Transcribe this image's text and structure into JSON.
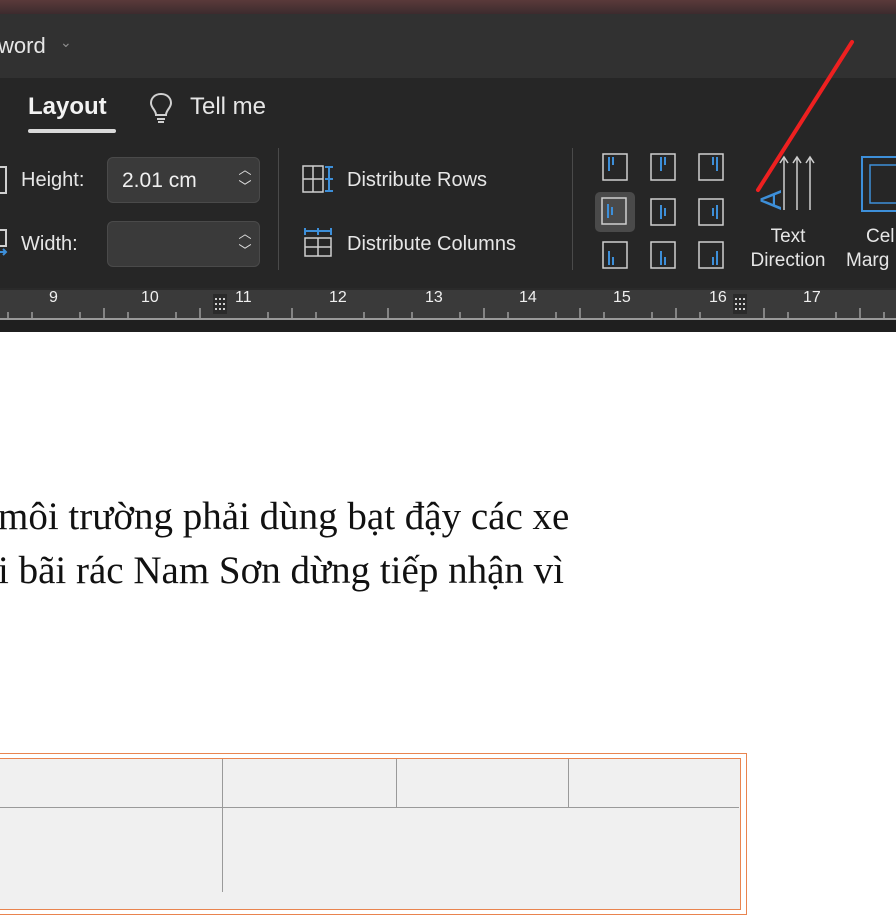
{
  "window": {
    "title": "word"
  },
  "tabs": [
    {
      "label": "Layout",
      "active": true
    },
    {
      "label": "Tell me",
      "icon": "lightbulb-icon"
    }
  ],
  "cell_size": {
    "height_label": "Height:",
    "height_value": "2.01 cm",
    "width_label": "Width:",
    "width_value": ""
  },
  "distribute": {
    "rows_label": "Distribute Rows",
    "columns_label": "Distribute Columns"
  },
  "alignment": {
    "selected": "middle-left",
    "buttons": [
      "top-left",
      "top-center",
      "top-right",
      "middle-left",
      "middle-center",
      "middle-right",
      "bottom-left",
      "bottom-center",
      "bottom-right"
    ]
  },
  "text_direction": {
    "line1": "Text",
    "line2": "Direction"
  },
  "cell_margins": {
    "line1": "Cel",
    "line2": "Marg"
  },
  "ruler": {
    "ticks": [
      "9",
      "10",
      "11",
      "12",
      "13",
      "14",
      "15",
      "16",
      "17"
    ]
  },
  "document": {
    "lines": [
      "môi trường phải dùng bạt đậy các xe",
      "i bãi rác Nam Sơn dừng tiếp nhận vì"
    ]
  },
  "colors": {
    "ribbon_bg": "#262626",
    "accent_blue": "#3d8fd9",
    "table_border": "#e9844f",
    "annotation_red": "#ee2020"
  }
}
